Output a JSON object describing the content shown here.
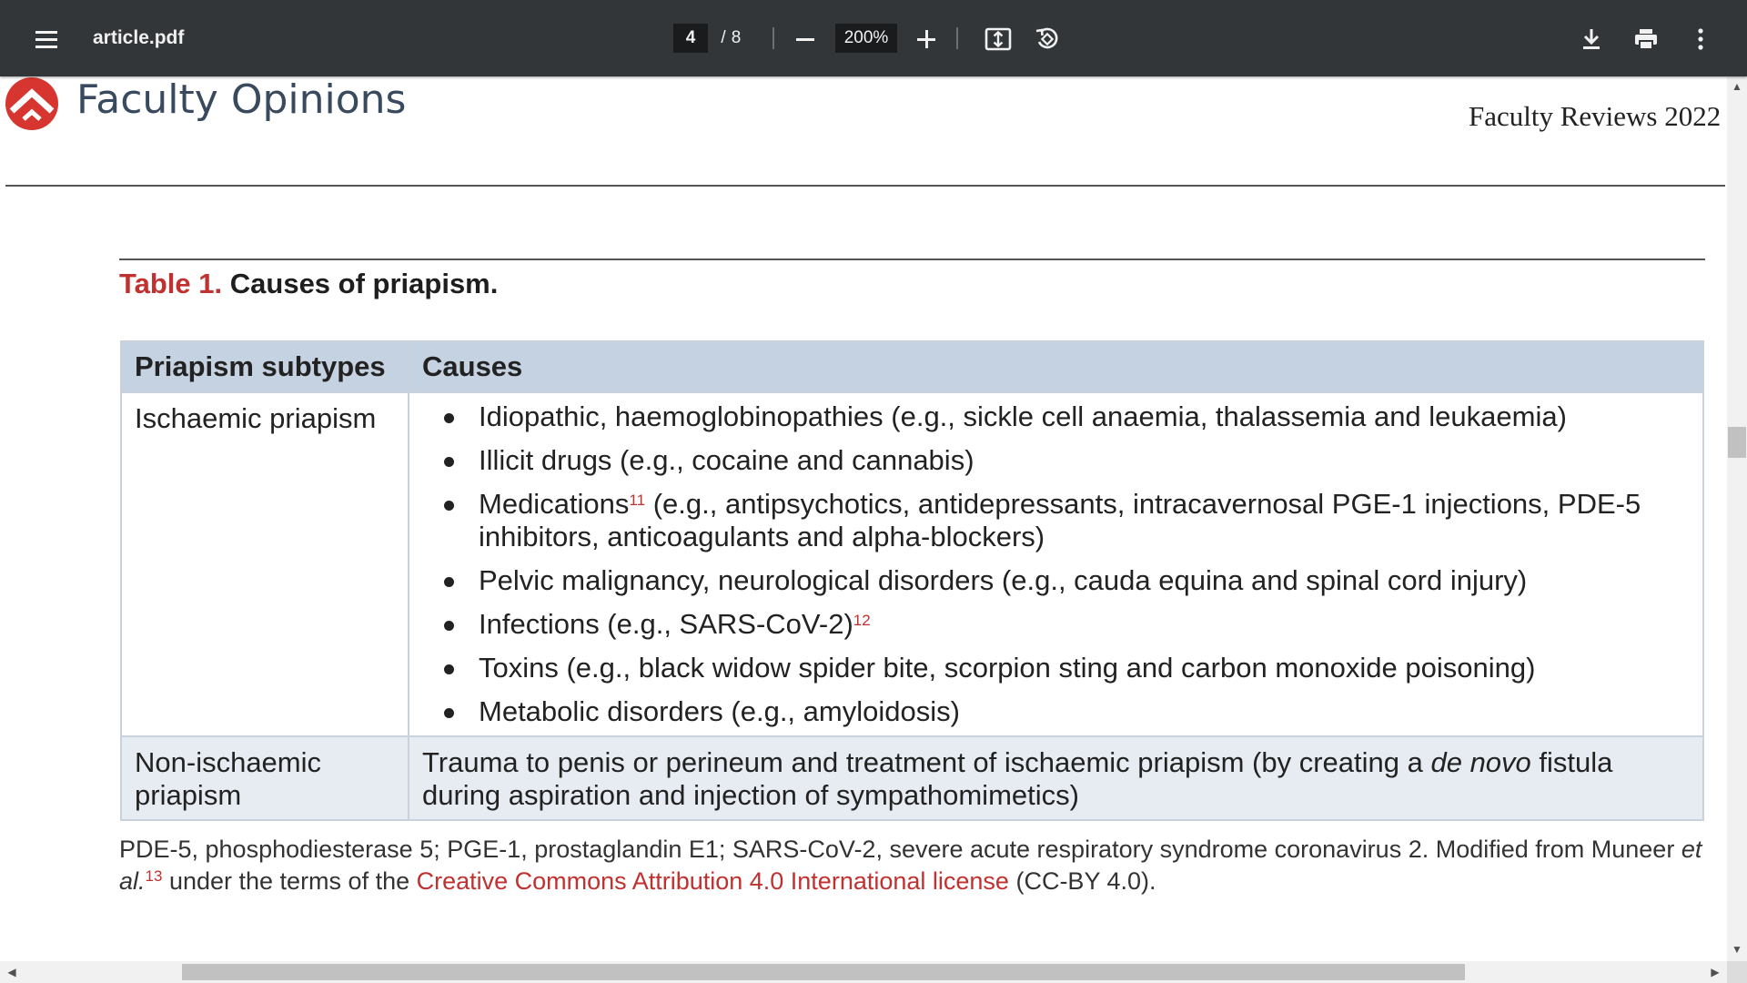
{
  "toolbar": {
    "file_name": "article.pdf",
    "page_current": "4",
    "page_separator": "/",
    "page_total": "8",
    "zoom": "200%",
    "icons": [
      "menu-icon",
      "zoom-out-icon",
      "zoom-in-icon",
      "fit-to-page-icon",
      "rotate-icon",
      "download-icon",
      "print-icon",
      "more-vert-icon"
    ],
    "colors": {
      "background": "#323639",
      "field": "#191b1c",
      "text": "#f1f1f1"
    }
  },
  "page": {
    "brand": "Faculty Opinions",
    "journal": "Faculty Reviews 2022",
    "table_label": "Table 1.",
    "table_title": "Causes of priapism.",
    "table": {
      "headers": [
        "Priapism subtypes",
        "Causes"
      ],
      "ischaemic": {
        "subtype": "Ischaemic priapism",
        "causes": [
          {
            "text": "Idiopathic, haemoglobinopathies (e.g., sickle cell anaemia, thalassemia and leukaemia)"
          },
          {
            "text": "Illicit drugs (e.g., cocaine and cannabis)"
          },
          {
            "prefix": "Medications",
            "ref": "11",
            "text": " (e.g., antipsychotics, antidepressants, intracavernosal PGE-1 injections, PDE-5 inhibitors, anticoagulants and alpha-blockers)"
          },
          {
            "text": "Pelvic malignancy, neurological disorders (e.g., cauda equina and spinal cord injury)"
          },
          {
            "text": "Infections (e.g., SARS-CoV-2)",
            "ref": "12"
          },
          {
            "text": "Toxins (e.g., black widow spider bite, scorpion sting and carbon monoxide poisoning)"
          },
          {
            "text": "Metabolic disorders (e.g., amyloidosis)"
          }
        ]
      },
      "non_ischaemic": {
        "subtype": "Non-ischaemic priapism",
        "cause_before": "Trauma to penis or perineum and treatment of ischaemic priapism (by creating a ",
        "cause_italic": "de novo",
        "cause_after": " fistula during aspiration and injection of sympathomimetics)"
      }
    },
    "footnote": {
      "text1": "PDE-5, phosphodiesterase 5; PGE-1, prostaglandin E1; SARS-CoV-2, severe acute respiratory syndrome coronavirus 2. Modified from Muneer ",
      "italic": "et al.",
      "ref": "13",
      "text2": " under the terms of the ",
      "link": "Creative Commons Attribution 4.0 International license",
      "text3": " (CC-BY 4.0)."
    },
    "colors": {
      "accent_red": "#c0312f",
      "header_bg": "#c5d2e2",
      "alt_row_bg": "#e7ecf2",
      "brand_text": "#3a4a5e"
    }
  }
}
